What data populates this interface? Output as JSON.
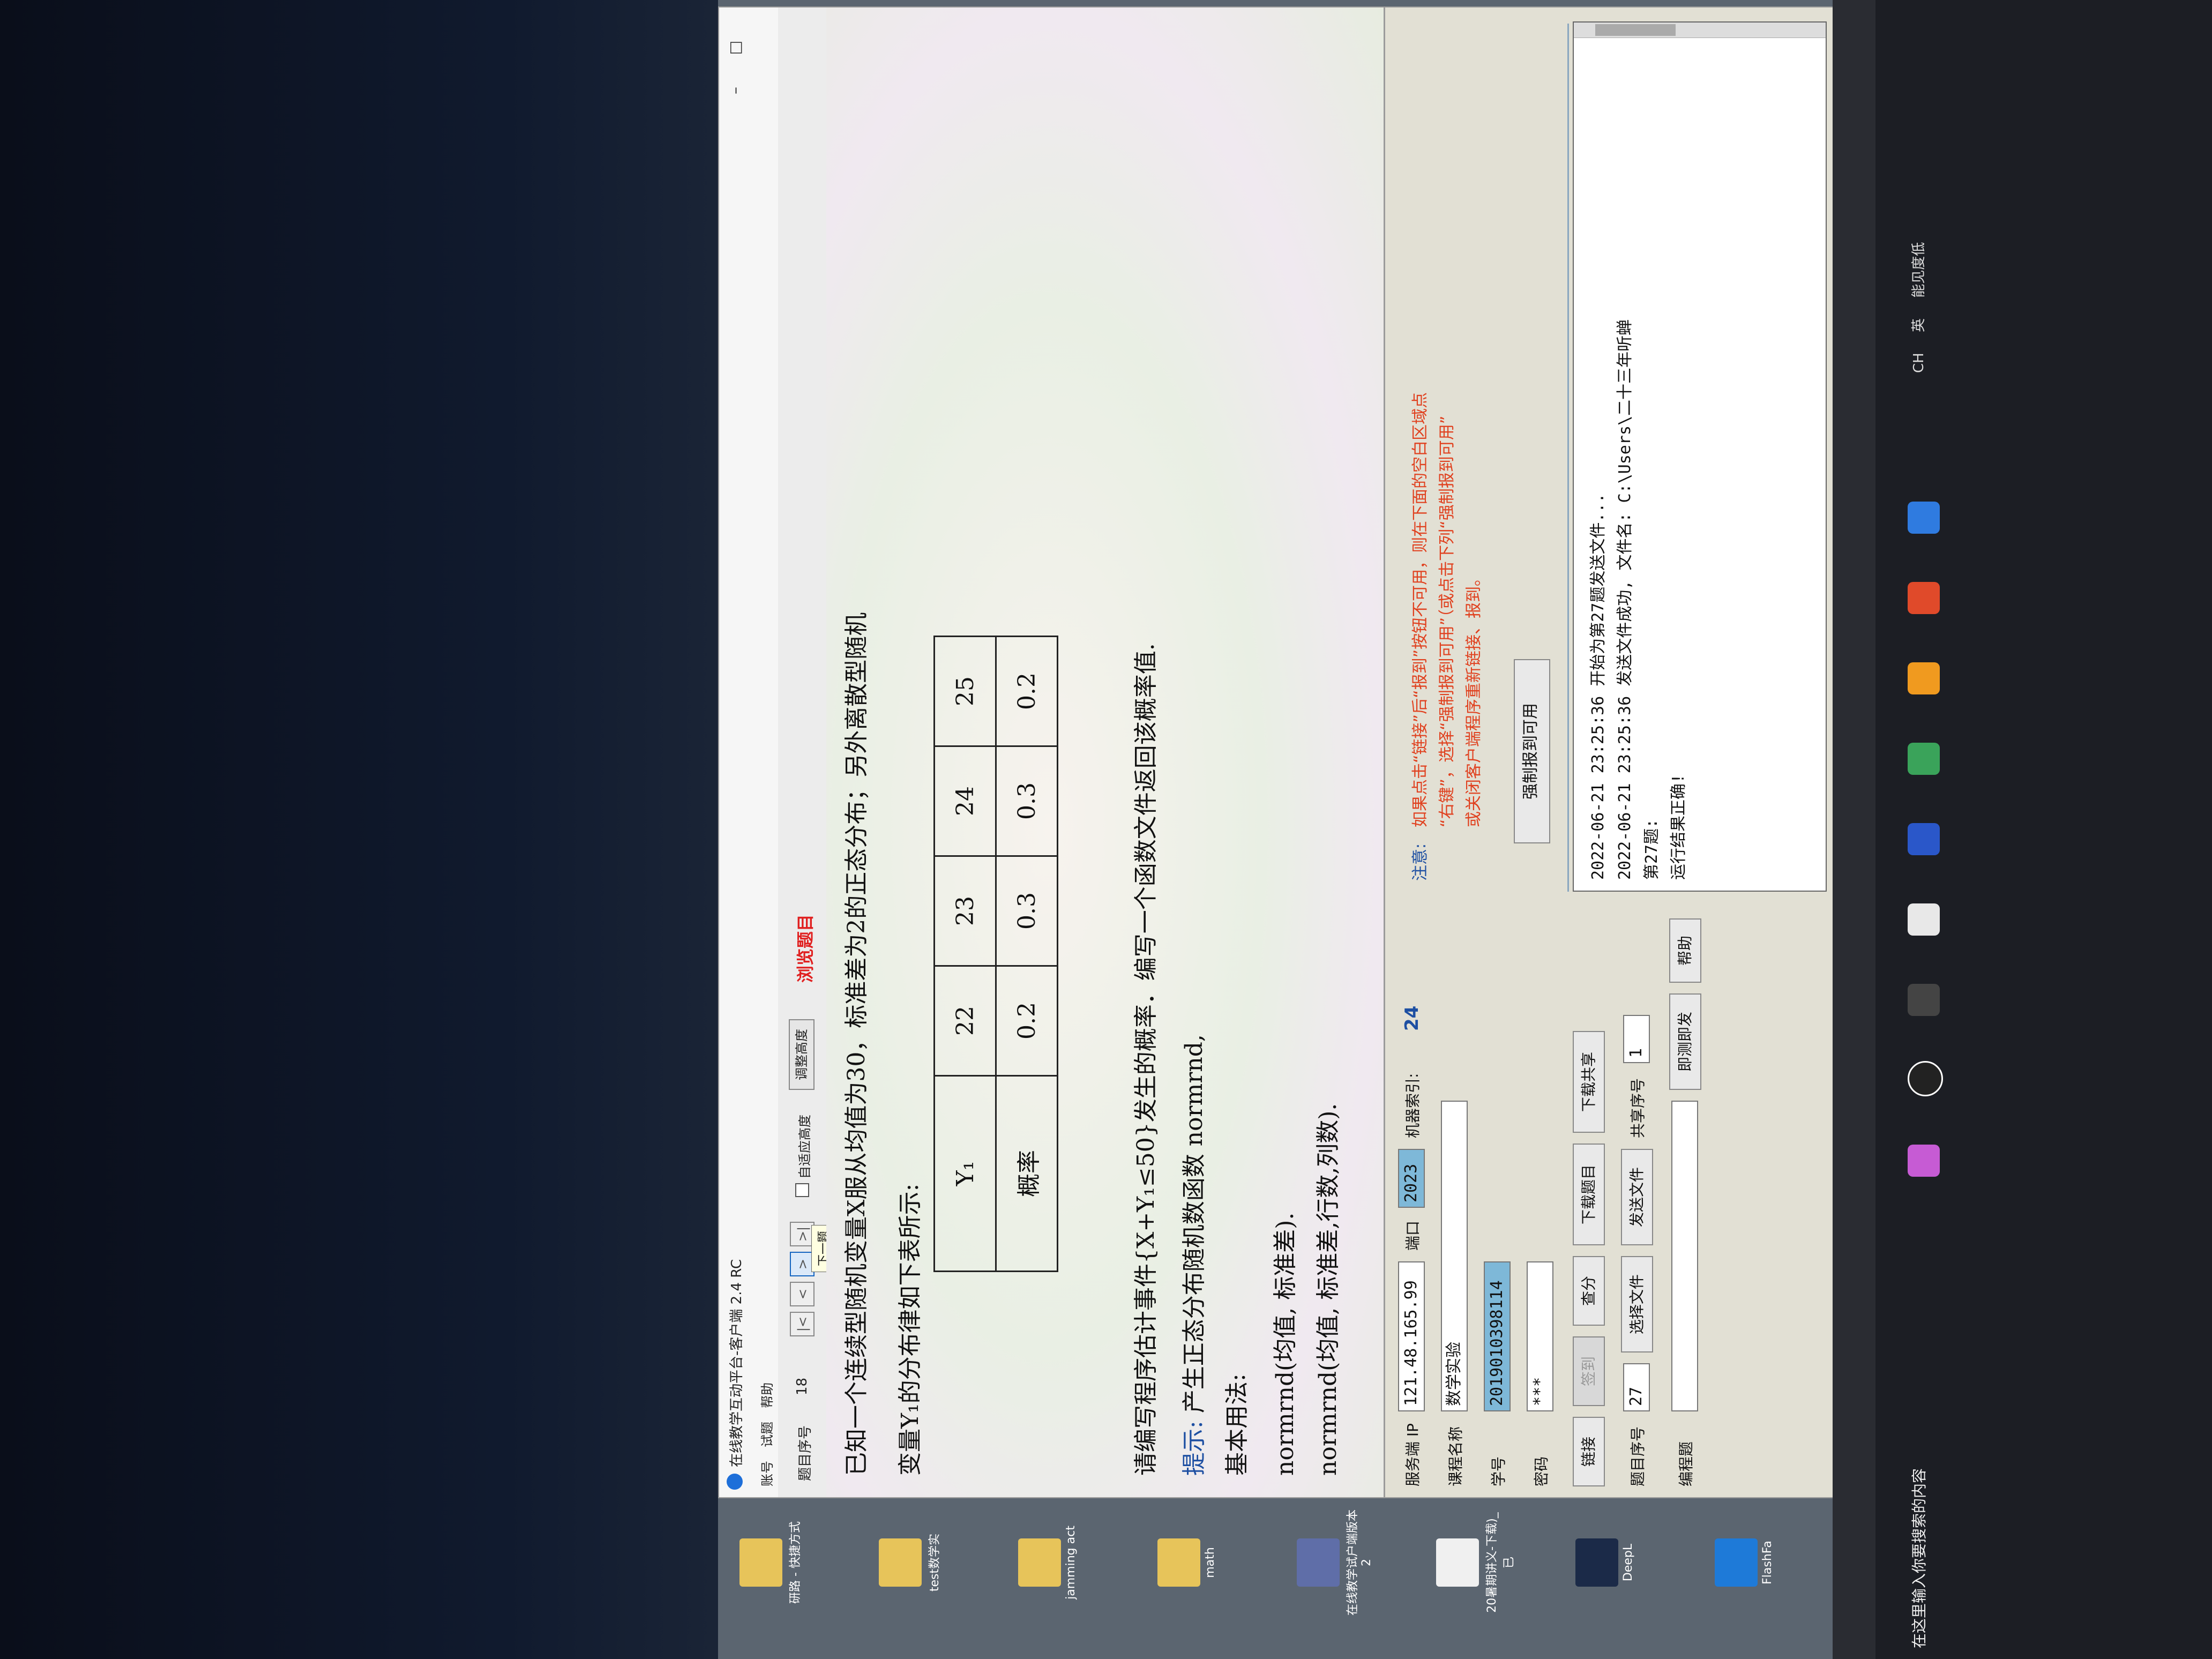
{
  "window": {
    "title": "在线教学互动平台-客户端 2.4 RC",
    "menus": [
      "账号",
      "试题",
      "帮助"
    ]
  },
  "toolbar": {
    "question_no_label": "题目序号",
    "question_no": "18",
    "nav_buttons": [
      "|<",
      "<",
      ">",
      ">|"
    ],
    "tooltip": "下一题",
    "auto_height_label": "自适应高度",
    "adjust_height_btn": "调整高度",
    "browse_label": "浏览题目"
  },
  "question": {
    "line1": "已知一个连续型随机变量X服从均值为30，标准差为2的正态分布；另外离散型随机",
    "line2": "变量Y₁的分布律如下表所示:",
    "table_header": [
      "Y₁",
      "22",
      "23",
      "24",
      "25"
    ],
    "table_row": [
      "概率",
      "0.2",
      "0.3",
      "0.3",
      "0.2"
    ],
    "line3": "请编写程序估计事件{X+Y₁≤50}发生的概率．编写一个函数文件返回该概率值.",
    "hint_title": "提示: ",
    "hint1": "产生正态分布随机数函数 normrnd,",
    "hint2": "基本用法:",
    "hint3": "normrnd(均值, 标准差).",
    "hint4": "normrnd(均值, 标准差,行数,列数)."
  },
  "form": {
    "server_ip_label": "服务端 IP",
    "server_ip": "121.48.165.99",
    "port_label": "端口",
    "port": "2023",
    "machine_index_label": "机器索引:",
    "machine_index": "24",
    "course_label": "课程名称",
    "course": "数学实验",
    "student_id_label": "学号",
    "student_id": "2019010398114",
    "password_label": "密码",
    "password": "***",
    "connect_btn": "链接",
    "signin_btn": "签到",
    "score_btn": "查分",
    "download_btn": "下载题目",
    "download_share_btn": "下载共享",
    "question_seq_label": "题目序号",
    "question_seq": "27",
    "choose_file_btn": "选择文件",
    "send_file_btn": "发送文件",
    "share_seq_label": "共享序号",
    "share_seq": "1",
    "instant_btn": "即测即发",
    "compile_label": "编程题",
    "help_btn": "帮助"
  },
  "notice": {
    "heading": "注意:",
    "lines": [
      "如果点击“链接”后“报到”按钮不可用，则在下面的空白区域点",
      "“右键”，选择“强制报到可用”（或点击下列“强制报到可用”",
      "或关闭客户端程序重新链接、报到。"
    ],
    "force_btn": "强制报到可用"
  },
  "log": {
    "lines": [
      "2022-06-21  23:25:36   开始为第27题发送文件...",
      "2022-06-21  23:25:36   发送文件成功, 文件名: C:\\Users\\二十三年听蝉",
      "第27题:",
      "运行结果正确!"
    ]
  },
  "desktop": {
    "icons": [
      "研路 - 快捷方式",
      "test数学实",
      "jamming act",
      "math",
      "在线教学试户端版本2",
      "20暑期讲义-下载)_已",
      "DeepL",
      "FlashFa"
    ]
  },
  "taskbar": {
    "search_placeholder": "在这里输入你要搜索的内容",
    "tray_text": "能见度低",
    "ime": "英",
    "lang": "CH"
  }
}
